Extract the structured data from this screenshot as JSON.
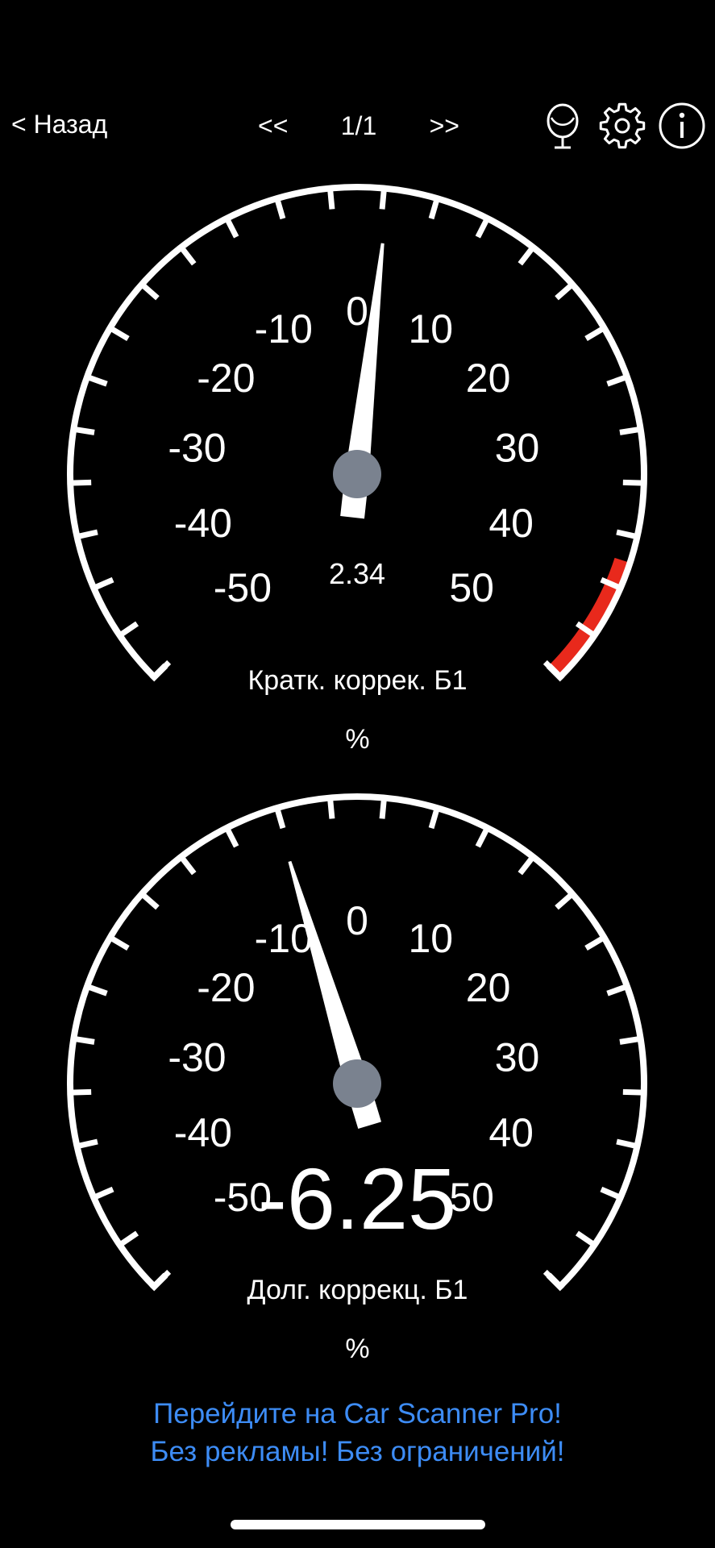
{
  "header": {
    "back_label": "< Назад",
    "prev_label": "<<",
    "page_label": "1/1",
    "next_label": ">>",
    "icons": [
      "mirror-icon",
      "gear-icon",
      "info-icon"
    ]
  },
  "gauges": [
    {
      "title": "Кратк. коррек. Б1",
      "unit": "%",
      "value": 2.34,
      "value_text": "2.34",
      "value_display": "small",
      "min": -50,
      "max": 50,
      "tick_labels": [
        "-50",
        "-40",
        "-30",
        "-20",
        "-10",
        "0",
        "10",
        "20",
        "30",
        "40",
        "50"
      ],
      "red_zone": [
        40,
        50
      ],
      "colors": {
        "needle": "#ffffff",
        "hub": "#7a828f",
        "red_zone": "#e8291c"
      }
    },
    {
      "title": "Долг. коррекц. Б1",
      "unit": "%",
      "value": -6.25,
      "value_text": "-6.25",
      "value_display": "large",
      "min": -50,
      "max": 50,
      "tick_labels": [
        "-50",
        "-40",
        "-30",
        "-20",
        "-10",
        "0",
        "10",
        "20",
        "30",
        "40",
        "50"
      ],
      "red_zone": null,
      "colors": {
        "needle": "#ffffff",
        "hub": "#7a828f",
        "red_zone": "#e8291c"
      }
    }
  ],
  "promo": {
    "line1": "Перейдите на Car Scanner Pro!",
    "line2": "Без рекламы! Без ограничений!",
    "color": "#3d8cf5"
  }
}
